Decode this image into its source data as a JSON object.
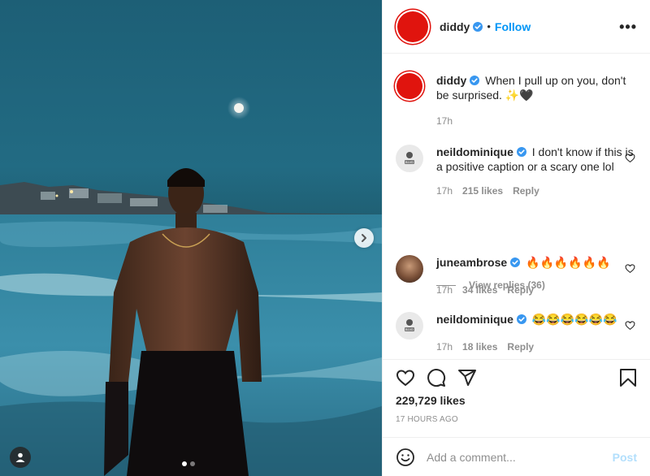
{
  "post": {
    "author": "diddy",
    "follow_label": "Follow",
    "separator": "•",
    "more_label": "•••",
    "caption": "When I pull up on you, don't be surprised. ✨🖤",
    "caption_time": "17h",
    "likes": "229,729 likes",
    "time_ago": "17 HOURS AGO",
    "comment_placeholder": "Add a comment...",
    "post_label": "Post",
    "carousel_index": 1,
    "carousel_count": 2
  },
  "comments": [
    {
      "username": "neildominique",
      "text": "I don't know if this is a positive caption or a scary one lol",
      "time": "17h",
      "likes": "215 likes",
      "reply_label": "Reply",
      "view_replies": "View replies (36)"
    },
    {
      "username": "juneambrose",
      "text": "🔥🔥🔥🔥🔥🔥",
      "time": "17h",
      "likes": "34 likes",
      "reply_label": "Reply"
    },
    {
      "username": "neildominique",
      "text": "😂😂😂😂😂😂",
      "time": "17h",
      "likes": "18 likes",
      "reply_label": "Reply"
    }
  ],
  "avatars": {
    "neildominique_badge": "BLVD"
  },
  "colors": {
    "accent": "#0095f6",
    "avatar_red": "#e0140e",
    "verified": "#3897f0",
    "muted": "#8e8e8e",
    "post_disabled": "#b2dffc"
  },
  "icons": [
    "verified-badge-icon",
    "more-options-icon",
    "heart-icon",
    "comment-icon",
    "share-icon",
    "bookmark-icon",
    "emoji-icon",
    "chevron-right-icon",
    "user-tag-icon"
  ]
}
